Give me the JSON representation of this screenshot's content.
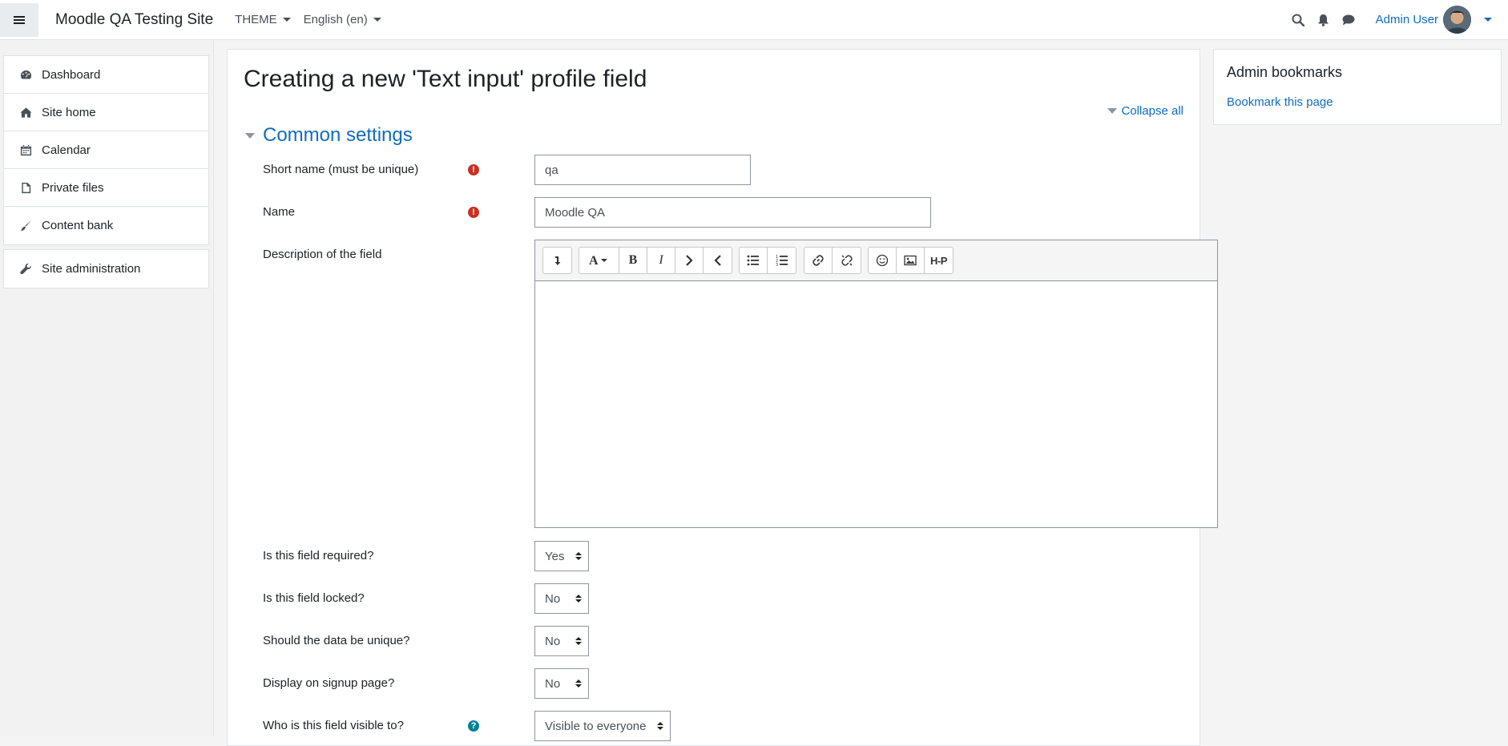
{
  "navbar": {
    "site_name": "Moodle QA Testing Site",
    "theme_menu": "THEME",
    "language_menu": "English (en)",
    "user_name": "Admin User"
  },
  "drawer": {
    "items": [
      {
        "label": "Dashboard",
        "icon": "dashboard-icon"
      },
      {
        "label": "Site home",
        "icon": "home-icon"
      },
      {
        "label": "Calendar",
        "icon": "calendar-icon"
      },
      {
        "label": "Private files",
        "icon": "file-icon"
      },
      {
        "label": "Content bank",
        "icon": "brush-icon"
      }
    ],
    "admin": {
      "label": "Site administration",
      "icon": "wrench-icon"
    }
  },
  "main": {
    "title": "Creating a new 'Text input' profile field",
    "collapse_all": "Collapse all",
    "section_title": "Common settings",
    "fields": {
      "shortname": {
        "label": "Short name (must be unique)",
        "value": "qa"
      },
      "name": {
        "label": "Name",
        "value": "Moodle QA"
      },
      "description": {
        "label": "Description of the field"
      },
      "required": {
        "label": "Is this field required?",
        "value": "Yes"
      },
      "locked": {
        "label": "Is this field locked?",
        "value": "No"
      },
      "unique": {
        "label": "Should the data be unique?",
        "value": "No"
      },
      "signup": {
        "label": "Display on signup page?",
        "value": "No"
      },
      "visible": {
        "label": "Who is this field visible to?",
        "value": "Visible to everyone"
      }
    },
    "editor_toolbar": {
      "b": "B",
      "i": "I",
      "h5p": "H-P"
    }
  },
  "block": {
    "title": "Admin bookmarks",
    "link": "Bookmark this page"
  },
  "colors": {
    "link": "#0f6cbf",
    "required": "#ca3120",
    "help": "#008196"
  }
}
